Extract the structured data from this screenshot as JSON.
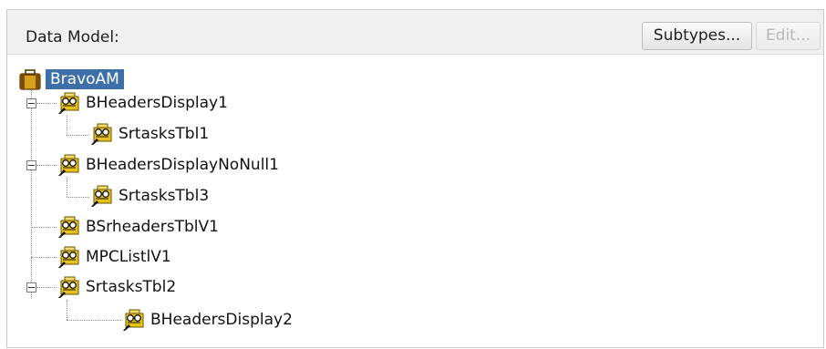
{
  "header": {
    "title": "Data Model:",
    "subtypes_button": "Subtypes...",
    "edit_button": "Edit..."
  },
  "tree": {
    "root": {
      "label": "BravoAM",
      "icon": "application-module-icon",
      "selected": true
    },
    "nodes": [
      {
        "label": "BHeadersDisplay1",
        "icon": "view-object-instance-icon",
        "expanded": true
      },
      {
        "label": "SrtasksTbl1",
        "icon": "view-object-instance-icon"
      },
      {
        "label": "BHeadersDisplayNoNull1",
        "icon": "view-object-instance-icon",
        "expanded": true
      },
      {
        "label": "SrtasksTbl3",
        "icon": "view-object-instance-icon"
      },
      {
        "label": "BSrheadersTblV1",
        "icon": "view-object-instance-icon"
      },
      {
        "label": "MPCListlV1",
        "icon": "view-object-instance-icon"
      },
      {
        "label": "SrtasksTbl2",
        "icon": "view-object-instance-icon",
        "expanded": true
      },
      {
        "label": "BHeadersDisplay2",
        "icon": "view-object-instance-icon"
      }
    ]
  },
  "colors": {
    "selection": "#3d6fa8",
    "header_bg": "#f0f0f0",
    "icon_yellow": "#e8c21a"
  }
}
